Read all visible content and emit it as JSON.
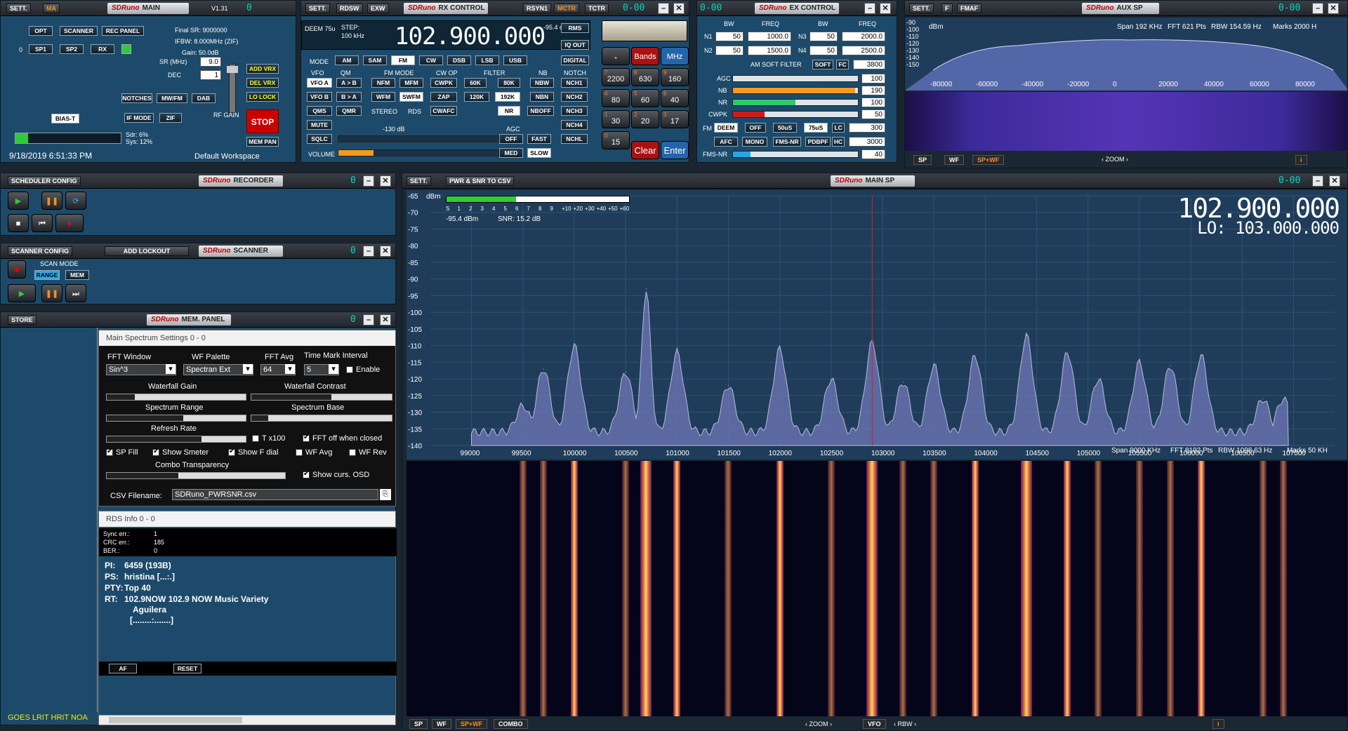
{
  "main": {
    "sett": "SETT.",
    "ma": "MA",
    "title": "MAIN",
    "version": "V1.31",
    "seg": "0",
    "buttons": [
      "OPT",
      "SCANNER",
      "REC PANEL",
      "SP1",
      "SP2",
      "RX"
    ],
    "zero": "0",
    "final_sr": "Final SR: 9000000",
    "ifbw": "IFBW: 8.000MHz (ZIF)",
    "gain": "Gain: 50.0dB",
    "sr_label": "SR (MHz)",
    "sr_value": "9.0",
    "dec_label": "DEC",
    "dec_value": "1",
    "notches": "NOTCHES",
    "mwfm": "MW/FM",
    "dab": "DAB",
    "ifmode": "IF MODE",
    "zif": "ZIF",
    "biast": "BIAS-T",
    "rfgain": "RF GAIN",
    "addvrx": "ADD VRX",
    "delvrx": "DEL VRX",
    "lolock": "LO LOCK",
    "stop": "STOP",
    "mempan": "MEM PAN",
    "sdr": "Sdr: 6%",
    "sys": "Sys: 12%",
    "datetime": "9/18/2019 6:51:33 PM",
    "workspace": "Default Workspace"
  },
  "rx": {
    "sett": "SETT.",
    "rdsw": "RDSW",
    "exw": "EXW",
    "title": "RX CONTROL",
    "rsyn": "RSYN1",
    "mctr": "MCTR",
    "tctr": "TCTR",
    "seg": "0-00",
    "deem": "DEEM 75u",
    "step": "STEP:",
    "step_val": "100 kHz",
    "freq": "102.900.000",
    "dbm": "-95.4 dBm",
    "rms": "RMS",
    "iqout": "IQ OUT",
    "digital": "DIGITAL",
    "mode_label": "MODE",
    "modes": [
      "AM",
      "SAM",
      "FM",
      "CW",
      "DSB",
      "LSB",
      "USB"
    ],
    "vfo": "VFO",
    "qm": "QM",
    "fmmode": "FM MODE",
    "cwop": "CW OP",
    "filter": "FILTER",
    "nb": "NB",
    "notch": "NOTCH",
    "row1": [
      "VFO A",
      "A > B",
      "NFM",
      "MFM",
      "CWPK",
      "60K",
      "80K",
      "NBW",
      "NCH1"
    ],
    "row2": [
      "VFO B",
      "B > A",
      "WFM",
      "SWFM",
      "ZAP",
      "120K",
      "192K",
      "NBN",
      "NCH2"
    ],
    "row3": [
      "QMS",
      "QMR",
      "STEREO",
      "RDS",
      "CWAFC",
      "NR",
      "NBOFF",
      "NCH3"
    ],
    "mute": "MUTE",
    "db130": "-130 dB",
    "agc": "AGC",
    "nch4": "NCH4",
    "sqlc": "SQLC",
    "off": "OFF",
    "fast": "FAST",
    "nchl": "NCHL",
    "volume": "VOLUME",
    "med": "MED",
    "slow": "SLOW",
    "bands": "Bands",
    "mhz": "MHz",
    "keys": [
      {
        "n": "7",
        "v": "2200"
      },
      {
        "n": "8",
        "v": "630"
      },
      {
        "n": "9",
        "v": "160"
      },
      {
        "n": "4",
        "v": "80"
      },
      {
        "n": "5",
        "v": "60"
      },
      {
        "n": "6",
        "v": "40"
      },
      {
        "n": "1",
        "v": "30"
      },
      {
        "n": "2",
        "v": "20"
      },
      {
        "n": "3",
        "v": "17"
      },
      {
        "n": "0",
        "v": "15"
      }
    ],
    "clear": "Clear",
    "enter": "Enter"
  },
  "ex": {
    "seg": "0-00",
    "title": "EX CONTROL",
    "bw": "BW",
    "freq": "FREQ",
    "n1": "N1",
    "n2": "N2",
    "n3": "N3",
    "n4": "N4",
    "n1bw": "50",
    "n1f": "1000.0",
    "n2bw": "50",
    "n2f": "1500.0",
    "n3bw": "50",
    "n3f": "2000.0",
    "n4bw": "50",
    "n4f": "2500.0",
    "amsoft": "AM SOFT FILTER",
    "soft": "SOFT",
    "fc": "FC",
    "fcv": "3800",
    "agc": "AGC",
    "agcv": "100",
    "nb": "NB",
    "nbv": "190",
    "nr": "NR",
    "nrv": "100",
    "cwpk": "CWPK",
    "cwpkv": "50",
    "fm": "FM",
    "deem": "DEEM",
    "off": "OFF",
    "us50": "50uS",
    "us75": "75uS",
    "lc": "LC",
    "lcv": "300",
    "afc": "AFC",
    "mono": "MONO",
    "fmsnr": "FMS-NR",
    "pdbpf": "PDBPF",
    "hc": "HC",
    "hcv": "3000",
    "fmsnr2": "FMS-NR",
    "fmsnrv": "40"
  },
  "aux": {
    "sett": "SETT.",
    "f": "F",
    "fmaf": "FMAF",
    "title": "AUX SP",
    "seg": "0-00",
    "dbm": "dBm",
    "yticks": [
      "-90",
      "-100",
      "-110",
      "-120",
      "-130",
      "-140",
      "-150"
    ],
    "span": "Span 192 KHz",
    "fft": "FFT 621 Pts",
    "rbw": "RBW 154.59 Hz",
    "marks": "Marks 2000 H",
    "xticks": [
      "-80000",
      "-60000",
      "-40000",
      "-20000",
      "0",
      "20000",
      "40000",
      "60000",
      "80000"
    ],
    "sp": "SP",
    "wf": "WF",
    "spwf": "SP+WF",
    "zoom": "ZOOM",
    "info": "i"
  },
  "sched": {
    "title": "SCHEDULER CONFIG",
    "logo": "RECORDER",
    "seg": "0"
  },
  "scan": {
    "title": "SCANNER CONFIG",
    "lockout": "ADD LOCKOUT",
    "logo": "SCANNER",
    "seg": "0",
    "scanmode": "SCAN MODE",
    "range": "RANGE",
    "mem": "MEM"
  },
  "mem": {
    "store": "STORE",
    "logo": "MEM. PANEL",
    "seg": "0",
    "ticker": "GOES LRIT HRIT NOA"
  },
  "settings": {
    "title": "Main Spectrum Settings 0 - 0",
    "fftwin": "FFT Window",
    "fftwin_v": "Sin^3",
    "wfpal": "WF Palette",
    "wfpal_v": "Spectran Ext",
    "fftavg": "FFT Avg",
    "fftavg_v": "64",
    "tmi": "Time Mark Interval",
    "tmi_v": "5",
    "enable": "Enable",
    "wfgain": "Waterfall Gain",
    "wfcon": "Waterfall Contrast",
    "sprange": "Spectrum Range",
    "spbase": "Spectrum Base",
    "refresh": "Refresh Rate",
    "tx100": "T x100",
    "fftoff": "FFT off when closed",
    "spfill": "SP Fill",
    "smeter": "Show Smeter",
    "fdial": "Show F dial",
    "wfavg": "WF Avg",
    "wfrev": "WF Rev",
    "combo": "Combo Transparency",
    "osd": "Show curs. OSD",
    "csv": "CSV Filename:",
    "csv_v": "SDRuno_PWRSNR.csv"
  },
  "rds": {
    "title": "RDS Info 0 - 0",
    "sync": "Sync err.:",
    "sync_v": "1",
    "crc": "CRC err.:",
    "crc_v": "185",
    "ber": "BER.:",
    "ber_v": "0",
    "pi": "PI:",
    "pi_v": "6459 (193B)",
    "ps": "PS:",
    "ps_v": "hristina [...:.]",
    "pty": "PTY:",
    "pty_v": "Top 40",
    "rt": "RT:",
    "rt_v": "102.9NOW 102.9 NOW Music Variety",
    "rt2": "Aguilera",
    "rt3": "[........:.......]",
    "af": "AF",
    "reset": "RESET"
  },
  "mainsp": {
    "sett": "SETT.",
    "pwr": "PWR & SNR TO CSV",
    "title": "MAIN SP",
    "seg": "0-00",
    "dbm": "dBm",
    "yticks": [
      "-65",
      "-70",
      "-75",
      "-80",
      "-85",
      "-90",
      "-95",
      "-100",
      "-105",
      "-110",
      "-115",
      "-120",
      "-125",
      "-130",
      "-135",
      "-140"
    ],
    "smeter_ticks": [
      "S",
      "1",
      "2",
      "3",
      "4",
      "5",
      "6",
      "7",
      "8",
      "9",
      "+10",
      "+20",
      "+30",
      "+40",
      "+50",
      "+60"
    ],
    "level": "-95.4 dBm",
    "snr": "SNR: 15.2 dB",
    "freq": "102.900.000",
    "lo": "LO: 103.000.000",
    "span": "Span 9000 KHz",
    "fft": "FFT 8192 Pts",
    "rbw": "RBW 1098.63 Hz",
    "marks": "Marks 50 KH",
    "xticks": [
      "99000",
      "99500",
      "100000",
      "100500",
      "101000",
      "101500",
      "102000",
      "102500",
      "103000",
      "103500",
      "104000",
      "104500",
      "105000",
      "105500",
      "106000",
      "106500",
      "107000",
      "107"
    ],
    "sp": "SP",
    "wf": "WF",
    "spwf": "SP+WF",
    "combo": "COMBO",
    "zoom": "ZOOM",
    "vfo": "VFO",
    "rbwb": "RBW",
    "info": "i"
  },
  "sdrlogo": "SDRuno",
  "chart_data": {
    "type": "area",
    "xlabel": "",
    "ylabel": "dBm",
    "xlim": [
      98600,
      107400
    ],
    "ylim": [
      -140,
      -65
    ],
    "x": [
      99500,
      99700,
      100000,
      100500,
      100700,
      101000,
      101500,
      102000,
      102500,
      102900,
      103200,
      103500,
      103900,
      104400,
      104800,
      105100,
      105500,
      105800,
      106100,
      106700,
      106900
    ],
    "values": [
      -128,
      -117,
      -110,
      -118,
      -93,
      -112,
      -122,
      -111,
      -120,
      -109,
      -121,
      -116,
      -113,
      -107,
      -112,
      -120,
      -115,
      -116,
      -113,
      -126,
      -126
    ]
  }
}
